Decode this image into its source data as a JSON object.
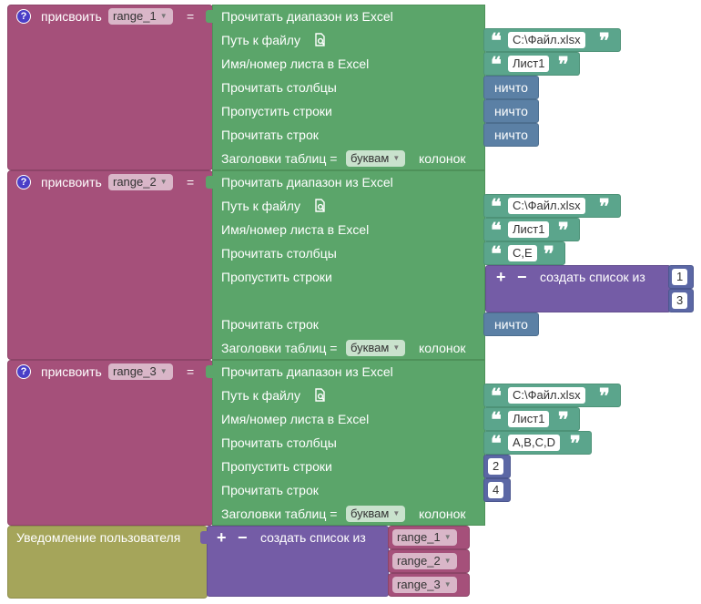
{
  "assign_blocks": [
    {
      "label": "присвоить",
      "var": "range_1",
      "eq": "="
    },
    {
      "label": "присвоить",
      "var": "range_2",
      "eq": "="
    },
    {
      "label": "присвоить",
      "var": "range_3",
      "eq": "="
    }
  ],
  "excel": {
    "title": "Прочитать диапазон из Excel",
    "path": "Путь к файлу",
    "sheet": "Имя/номер листа в Excel",
    "cols": "Прочитать столбцы",
    "skip": "Пропустить строки",
    "rows": "Прочитать строк",
    "headers": "Заголовки таблиц =",
    "headers_opt": "буквам",
    "headers_suffix": "колонок"
  },
  "values": {
    "file": "C:\\Файл.xlsx",
    "sheet": "Лист1",
    "nothing": "ничто",
    "cols_2": "C,E",
    "cols_3": "A,B,C,D",
    "skip_2": [
      "1",
      "3"
    ],
    "skip_3": "2",
    "rows_3": "4"
  },
  "list_block": {
    "plus": "+",
    "minus": "−",
    "label": "создать список из"
  },
  "notify": {
    "label": "Уведомление пользователя",
    "items": [
      "range_1",
      "range_2",
      "range_3"
    ]
  },
  "icons": {
    "help": "?",
    "quote_open": "❝",
    "quote_close": "❞",
    "file": "search-file-icon",
    "dropdown": "▼"
  }
}
